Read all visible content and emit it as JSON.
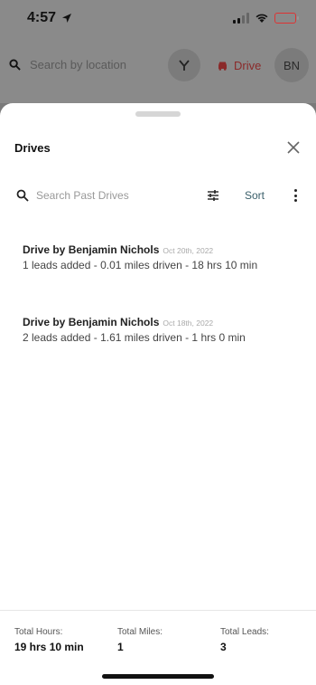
{
  "status_bar": {
    "time": "4:57"
  },
  "background": {
    "search_placeholder": "Search by location",
    "drive_label": "Drive",
    "avatar_initials": "BN",
    "colors": {
      "drive": "#8a2a2a"
    }
  },
  "sheet": {
    "title": "Drives",
    "search_placeholder": "Search Past Drives",
    "sort_label": "Sort",
    "drives": [
      {
        "title": "Drive by Benjamin Nichols",
        "date": "Oct 20th, 2022",
        "details": "1 leads added - 0.01 miles driven - 18 hrs 10 min"
      },
      {
        "title": "Drive by Benjamin Nichols",
        "date": "Oct 18th, 2022",
        "details": "2 leads added - 1.61 miles driven - 1 hrs 0 min"
      }
    ],
    "totals": [
      {
        "label": "Total Hours:",
        "value": "19 hrs 10 min"
      },
      {
        "label": "Total Miles:",
        "value": "1"
      },
      {
        "label": "Total Leads:",
        "value": "3"
      }
    ]
  },
  "icons": [
    "location-arrow-icon",
    "signal-icon",
    "wifi-icon",
    "battery-icon",
    "search-icon",
    "filter-icon",
    "car-icon",
    "close-icon",
    "sliders-icon",
    "more-vertical-icon"
  ],
  "colors": {
    "accent_sort": "#3a5f6a",
    "battery": "#d33333"
  }
}
